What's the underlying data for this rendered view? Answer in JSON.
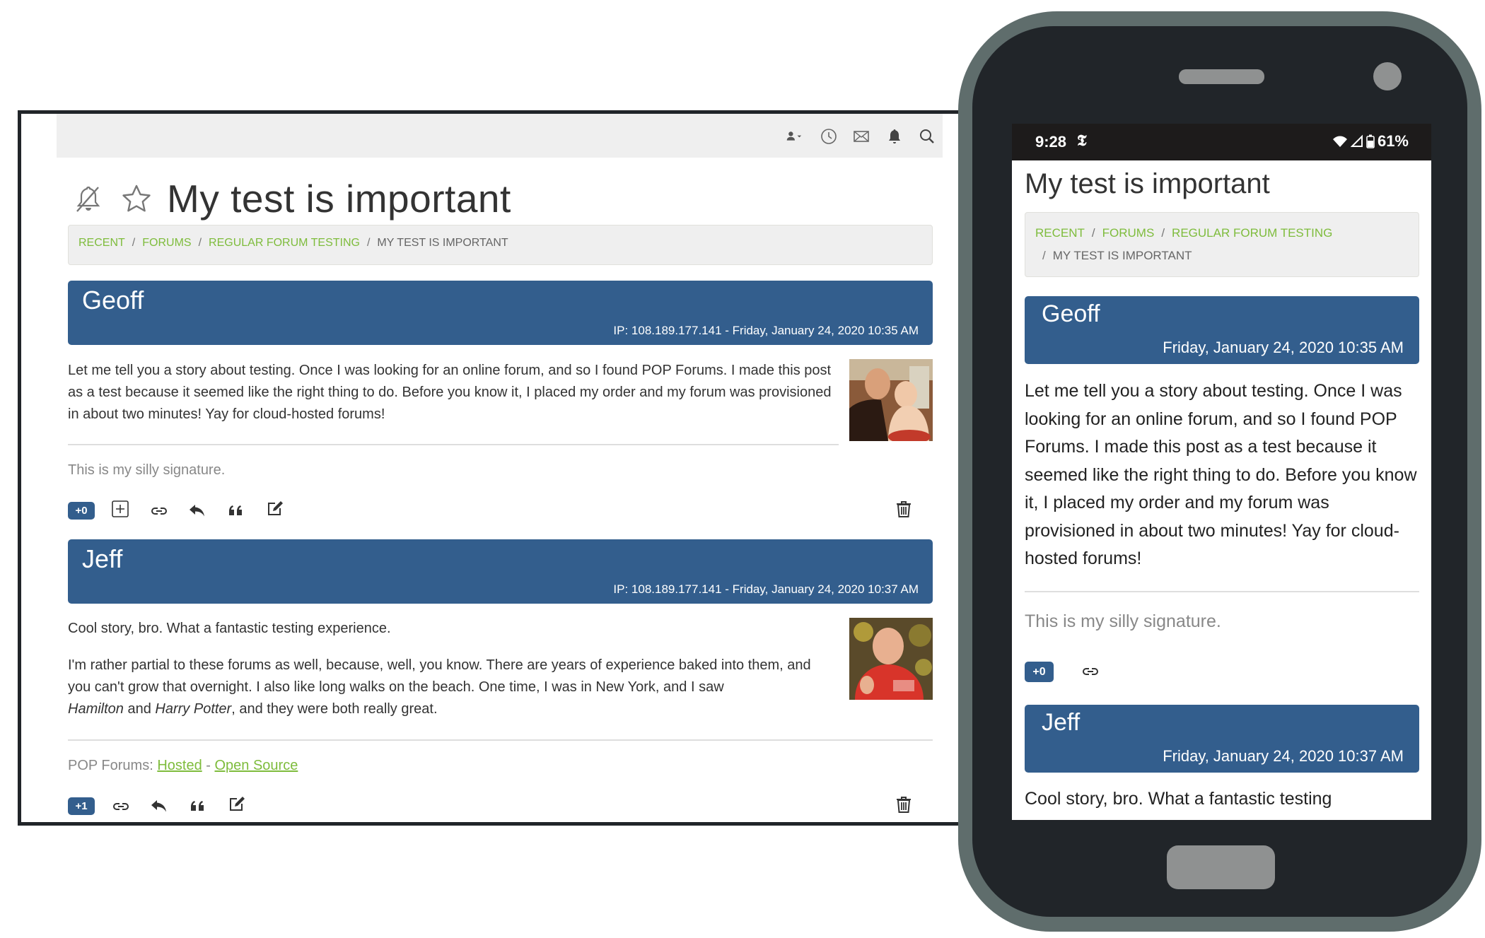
{
  "colors": {
    "accent_blue": "#335e8d",
    "link_green": "#7ebc3c",
    "navbar_bg": "#efefef",
    "frame_dark": "#212529",
    "phone_shell": "#5f6d6c"
  },
  "desktop": {
    "navbar": {
      "icons": [
        "user-menu-icon",
        "recent-clock-icon",
        "messages-envelope-icon",
        "notifications-bell-icon",
        "search-icon"
      ]
    },
    "title_icons": [
      "bell-slash-icon",
      "star-outline-icon"
    ],
    "title": "My test is important",
    "breadcrumb": {
      "links": [
        "RECENT",
        "FORUMS",
        "REGULAR FORUM TESTING"
      ],
      "current": "MY TEST IS IMPORTANT",
      "separator": "/"
    },
    "posts": [
      {
        "author": "Geoff",
        "meta": "IP: 108.189.177.141 - Friday, January 24, 2020 10:35 AM",
        "paragraphs": [
          "Let me tell you a story about testing. Once I was looking for an online forum, and so I found POP Forums. I made this post as a test because it seemed like the right thing to do. Before you know it, I placed my order and my forum was provisioned in about two minutes! Yay for cloud-hosted forums!"
        ],
        "signature": "This is my silly signature.",
        "votes": "+0",
        "actions": [
          "vote-plus-icon",
          "link-icon",
          "reply-icon",
          "quote-icon",
          "edit-icon",
          "delete-trash-icon"
        ]
      },
      {
        "author": "Jeff",
        "meta": "IP: 108.189.177.141 - Friday, January 24, 2020 10:37 AM",
        "paragraphs": [
          "Cool story, bro. What a fantastic testing experience.",
          "I'm rather partial to these forums as well, because, well, you know. There are years of experience baked into them, and you can't grow that overnight. I also like long walks on the beach. One time, I was in New York, and I saw"
        ],
        "italic_1": "Hamilton",
        "and_text": " and ",
        "italic_2": "Harry Potter",
        "tail_text": ", and they were both really great.",
        "signature_prefix": "POP Forums: ",
        "signature_link_1": "Hosted",
        "signature_sep": " - ",
        "signature_link_2": "Open Source",
        "votes": "+1",
        "actions": [
          "link-icon",
          "reply-icon",
          "quote-icon",
          "edit-icon",
          "delete-trash-icon"
        ]
      }
    ]
  },
  "mobile": {
    "status_bar": {
      "time": "9:28",
      "app_icon": "nyt-t-icon",
      "battery": "61%",
      "icons": [
        "wifi-icon",
        "cell-signal-icon",
        "battery-icon"
      ]
    },
    "title": "My test is important",
    "breadcrumb": {
      "links": [
        "RECENT",
        "FORUMS",
        "REGULAR FORUM TESTING"
      ],
      "current": "MY TEST IS IMPORTANT",
      "separator": "/"
    },
    "posts": [
      {
        "author": "Geoff",
        "meta": "Friday, January 24, 2020 10:35 AM",
        "body": "Let me tell you a story about testing. Once I was looking for an online forum, and so I found POP Forums. I made this post as a test because it seemed like the right thing to do. Before you know it, I placed my order and my forum was provisioned in about two minutes! Yay for cloud-hosted forums!",
        "signature": "This is my silly signature.",
        "votes": "+0"
      },
      {
        "author": "Jeff",
        "meta": "Friday, January 24, 2020 10:37 AM",
        "body": "Cool story, bro. What a fantastic testing"
      }
    ]
  }
}
